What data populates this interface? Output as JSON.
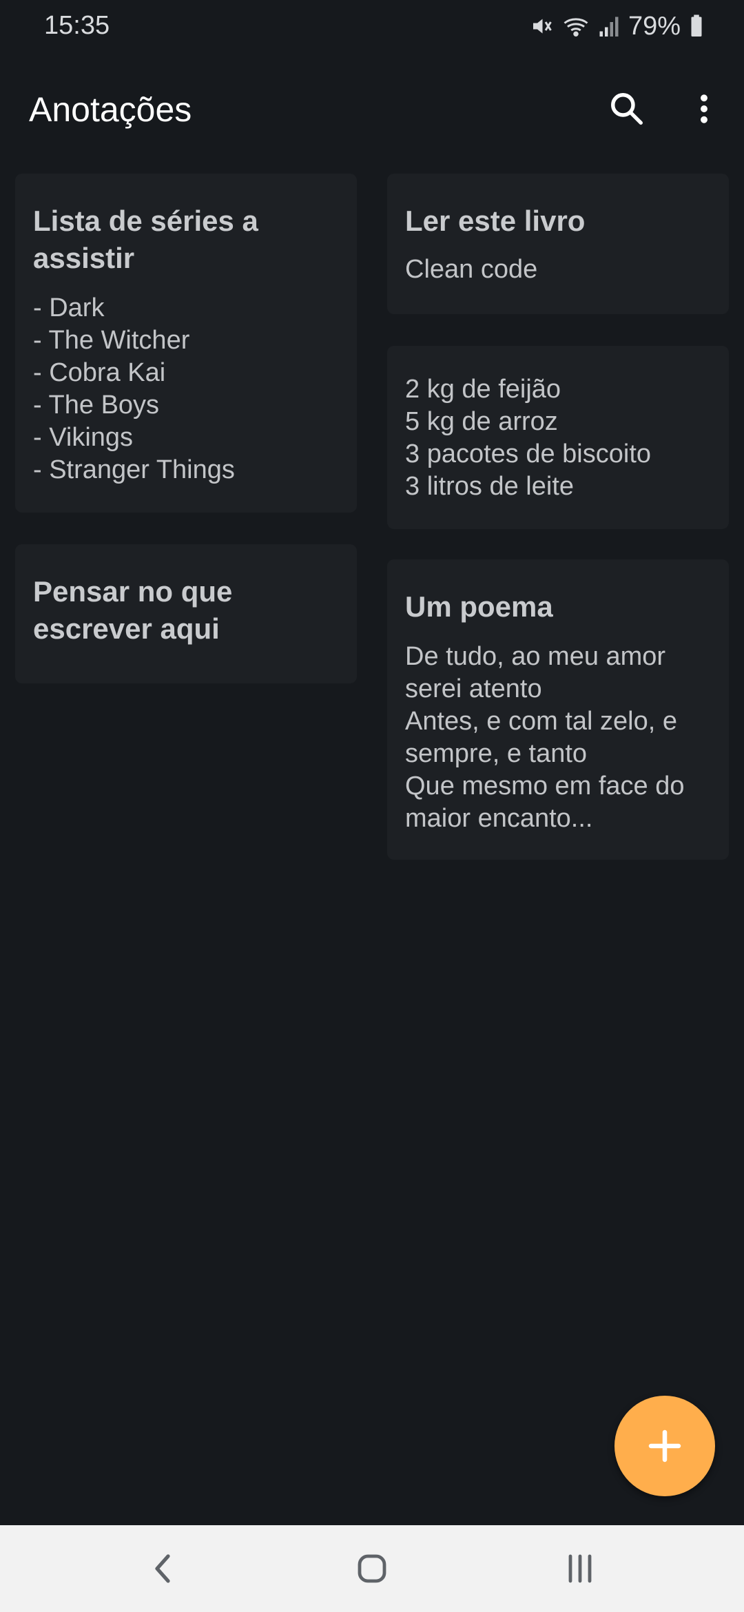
{
  "status_bar": {
    "time": "15:35",
    "battery": "79%",
    "icons": [
      "mute-icon",
      "wifi-icon",
      "signal-icon",
      "battery-icon"
    ]
  },
  "app_bar": {
    "title": "Anotações",
    "icons": [
      "search-icon",
      "more-vert-icon"
    ]
  },
  "notes": [
    {
      "title": "Lista de séries a assistir",
      "body": "- Dark\n- The Witcher\n- Cobra Kai\n- The Boys\n- Vikings\n- Stranger Things"
    },
    {
      "title": "Ler este livro",
      "body": "Clean code"
    },
    {
      "title": "",
      "body": "2 kg de feijão\n5 kg de arroz\n3 pacotes de biscoito\n3 litros de leite"
    },
    {
      "title": "Pensar no que escrever aqui",
      "body": ""
    },
    {
      "title": "Um poema",
      "body": "De tudo, ao meu amor serei atento\nAntes, e com tal zelo, e sempre, e tanto\nQue mesmo em face do maior encanto..."
    }
  ],
  "fab": {
    "icon": "plus-icon",
    "color": "#ffae4c"
  },
  "nav_bar": {
    "icons": [
      "back-icon",
      "home-icon",
      "recents-icon"
    ]
  },
  "colors": {
    "background": "#16191d",
    "card": "#1d2024",
    "accent": "#ffae4c",
    "nav_background": "#f2f2f2"
  }
}
